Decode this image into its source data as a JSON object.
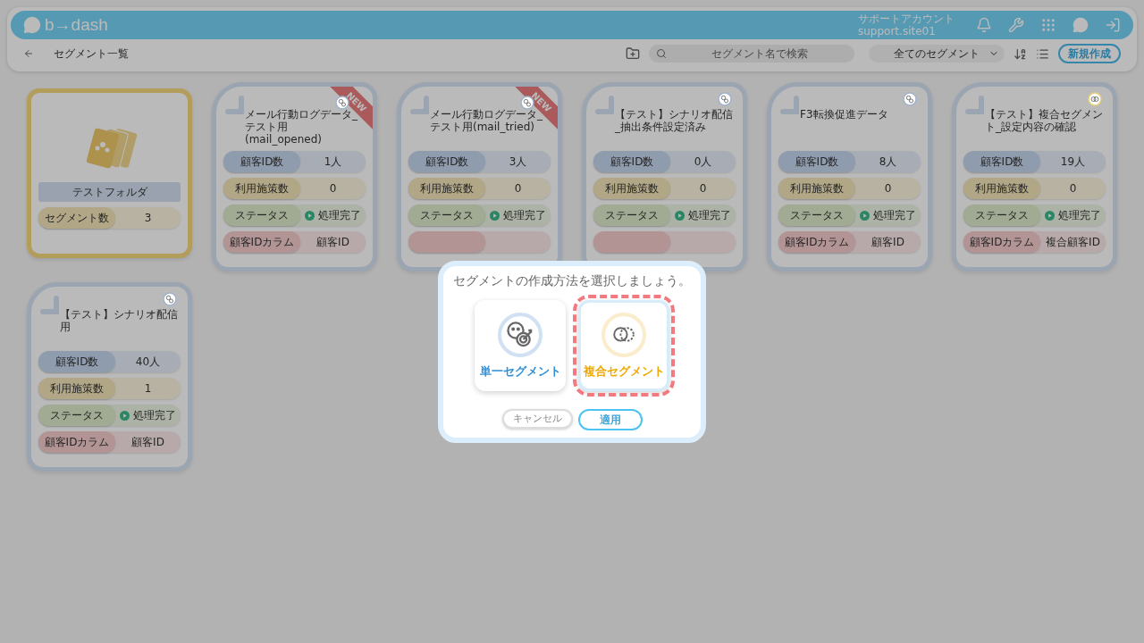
{
  "header": {
    "logo": "b→dash",
    "account_name": "サポートアカウント",
    "account_id": "support.site01"
  },
  "toolbar": {
    "title": "セグメント一覧",
    "search": {
      "placeholder": "セグメント名で検索"
    },
    "filter": "全てのセグメント",
    "new_button": "新規作成"
  },
  "cards": [
    {
      "kind": "folder",
      "name": "テストフォルダ",
      "rows": [
        {
          "kind": "count",
          "label": "セグメント数",
          "value": "3"
        }
      ]
    },
    {
      "kind": "single",
      "badge": "NEW",
      "name": "メール行動ログデータ_テスト用(mail_opened)",
      "rows": [
        {
          "kind": "customers",
          "label": "顧客ID数",
          "value": "1人"
        },
        {
          "kind": "measures",
          "label": "利用施策数",
          "value": "0"
        },
        {
          "kind": "status",
          "label": "ステータス",
          "value": "処理完了"
        },
        {
          "kind": "column",
          "label": "顧客IDカラム",
          "value": "顧客ID"
        }
      ]
    },
    {
      "kind": "single",
      "badge": "NEW",
      "name": "メール行動ログデータ_テスト用(mail_tried)",
      "rows": [
        {
          "kind": "customers",
          "label": "顧客ID数",
          "value": "3人"
        },
        {
          "kind": "measures",
          "label": "利用施策数",
          "value": "0"
        },
        {
          "kind": "status",
          "label": "ステータス",
          "value": "処理完了"
        },
        {
          "kind": "column"
        }
      ]
    },
    {
      "kind": "single",
      "name": "【テスト】シナリオ配信_抽出条件設定済み",
      "rows": [
        {
          "kind": "customers",
          "label": "顧客ID数",
          "value": "0人"
        },
        {
          "kind": "measures",
          "label": "利用施策数",
          "value": "0"
        },
        {
          "kind": "status",
          "label": "ステータス",
          "value": "処理完了"
        },
        {
          "kind": "column"
        }
      ]
    },
    {
      "kind": "single",
      "name": "F3転換促進データ",
      "rows": [
        {
          "kind": "customers",
          "label": "顧客ID数",
          "value": "8人"
        },
        {
          "kind": "measures",
          "label": "利用施策数",
          "value": "0"
        },
        {
          "kind": "status",
          "label": "ステータス",
          "value": "処理完了"
        },
        {
          "kind": "column",
          "label": "顧客IDカラム",
          "value": "顧客ID"
        }
      ]
    },
    {
      "kind": "composite",
      "name": "【テスト】複合セグメント_設定内容の確認",
      "rows": [
        {
          "kind": "customers",
          "label": "顧客ID数",
          "value": "19人"
        },
        {
          "kind": "measures",
          "label": "利用施策数",
          "value": "0"
        },
        {
          "kind": "status",
          "label": "ステータス",
          "value": "処理完了"
        },
        {
          "kind": "column",
          "label": "顧客IDカラム",
          "value": "複合顧客ID"
        }
      ]
    },
    {
      "kind": "single",
      "name": "【テスト】シナリオ配信用",
      "rows": [
        {
          "kind": "customers",
          "label": "顧客ID数",
          "value": "40人"
        },
        {
          "kind": "measures",
          "label": "利用施策数",
          "value": "1"
        },
        {
          "kind": "status",
          "label": "ステータス",
          "value": "処理完了"
        },
        {
          "kind": "column",
          "label": "顧客IDカラム",
          "value": "顧客ID"
        }
      ]
    }
  ],
  "modal": {
    "title": "セグメントの作成方法を選択しましょう。",
    "options": [
      {
        "kind": "single",
        "label": "単一セグメント",
        "selected": false
      },
      {
        "kind": "composite",
        "label": "複合セグメント",
        "selected": true
      }
    ],
    "cancel": "キャンセル",
    "apply": "適用"
  }
}
